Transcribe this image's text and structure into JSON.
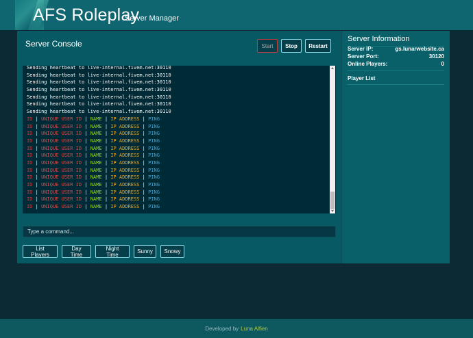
{
  "header": {
    "title": "AFS Roleplay",
    "subtitle": "Server Manager"
  },
  "console_panel": {
    "title": "Server Console",
    "buttons": {
      "start": "Start",
      "stop": "Stop",
      "restart": "Restart"
    },
    "heartbeat_lines": [
      "Sending heartbeat to live-internal.fivem.net:30110",
      "Sending heartbeat to live-internal.fivem.net:30110",
      "Sending heartbeat to live-internal.fivem.net:30110",
      "Sending heartbeat to live-internal.fivem.net:30110",
      "Sending heartbeat to live-internal.fivem.net:30110",
      "Sending heartbeat to live-internal.fivem.net:30110",
      "Sending heartbeat to live-internal.fivem.net:30110"
    ],
    "player_table_header": {
      "id": "ID",
      "unique_user_id": "UNIQUE USER ID",
      "name": "NAME",
      "ip_address": "IP ADDRESS",
      "ping": "PING",
      "separator": "|",
      "repeat_count": 13
    },
    "command_placeholder": "Type a command...",
    "quick_buttons": [
      "List Players",
      "Day Time",
      "Night Time",
      "Sunny",
      "Snowy"
    ]
  },
  "server_info": {
    "title": "Server Information",
    "ip_label": "Server IP:",
    "ip_value": "gs.lunarwebsite.ca",
    "port_label": "Server Port:",
    "port_value": "30120",
    "players_label": "Online Players:",
    "players_value": "0",
    "player_list_title": "Player List"
  },
  "footer": {
    "prefix": "Developed by",
    "author": "Luna Alfien"
  },
  "colors": {
    "id": "#d03838",
    "unique_user_id": "#e04848",
    "name": "#9bd80f",
    "ip_address": "#e8a92a",
    "ping": "#3aa7e0"
  }
}
